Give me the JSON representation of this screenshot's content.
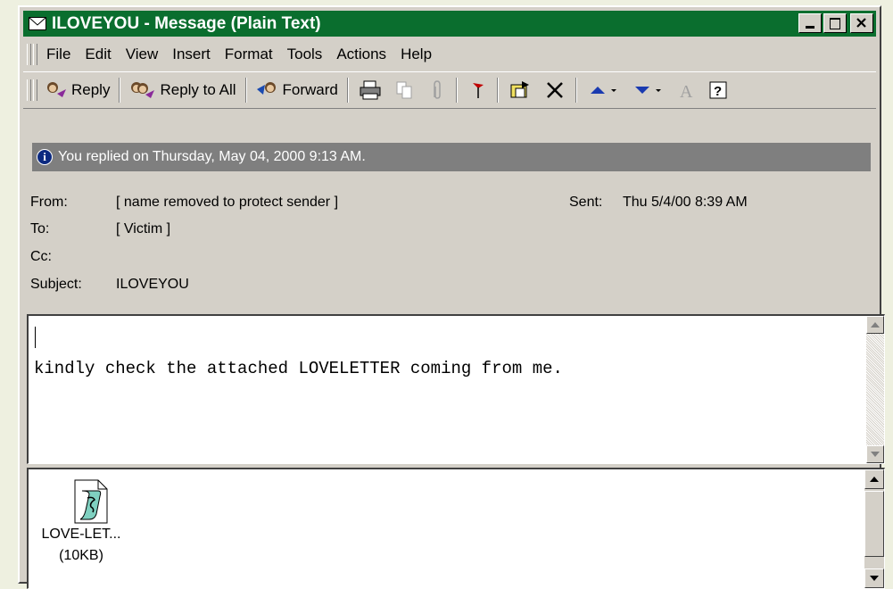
{
  "window": {
    "title": "ILOVEYOU - Message (Plain Text)",
    "title_bar_color": "#0a6e2e"
  },
  "menu": {
    "items": [
      {
        "label": "File",
        "icon": null
      },
      {
        "label": "Edit"
      },
      {
        "label": "View"
      },
      {
        "label": "Insert"
      },
      {
        "label": "Format"
      },
      {
        "label": "Tools"
      },
      {
        "label": "Actions"
      },
      {
        "label": "Help"
      }
    ]
  },
  "toolbar": {
    "reply_label": "Reply",
    "reply_all_label": "Reply to All",
    "forward_label": "Forward",
    "icons": [
      "print-icon",
      "copy-icon",
      "attach-icon",
      "flag-icon",
      "move-to-folder-icon",
      "delete-icon",
      "previous-item-icon",
      "next-item-icon",
      "font-icon",
      "help-icon"
    ]
  },
  "info": {
    "text": "You replied on Thursday, May 04, 2000 9:13 AM."
  },
  "header": {
    "from_label": "From:",
    "from_value": "[ name removed to protect sender ]",
    "sent_label": "Sent:",
    "sent_value": "Thu 5/4/00 8:39 AM",
    "to_label": "To:",
    "to_value": "[ Victim ]",
    "cc_label": "Cc:",
    "cc_value": "",
    "subject_label": "Subject:",
    "subject_value": "ILOVEYOU"
  },
  "message": {
    "body": "kindly check the attached LOVELETTER coming from me."
  },
  "attachment": {
    "name": "LOVE-LET...",
    "size": "(10KB)",
    "icon": "script-file-icon"
  }
}
